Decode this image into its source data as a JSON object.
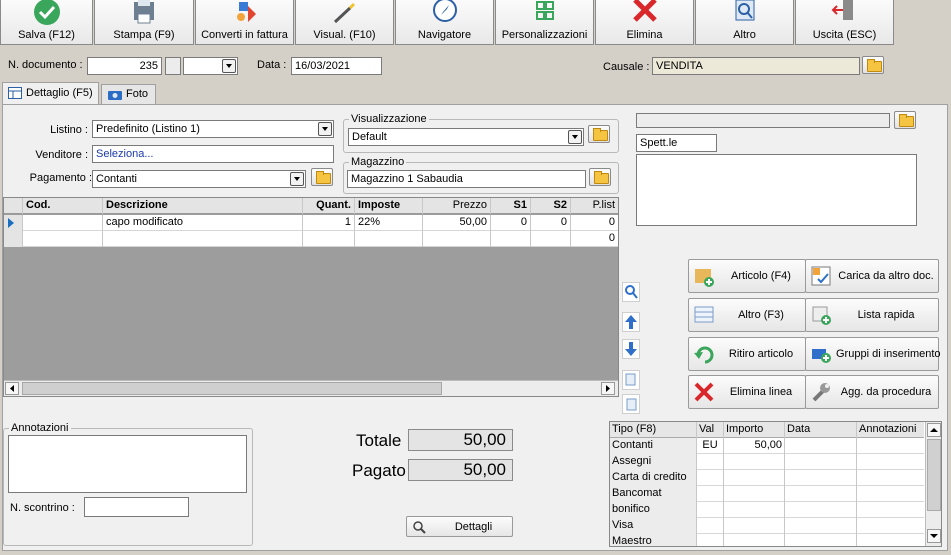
{
  "toolbar": {
    "save": "Salva (F12)",
    "print": "Stampa (F9)",
    "convert": "Converti in fattura",
    "visual": "Visual. (F10)",
    "navigator": "Navigatore",
    "custom": "Personalizzazioni",
    "delete": "Elimina",
    "other": "Altro",
    "exit": "Uscita (ESC)"
  },
  "header": {
    "doc_label": "N. documento :",
    "doc_number": "235",
    "date_label": "Data :",
    "date": "16/03/2021",
    "causale_label": "Causale :",
    "causale": "VENDITA"
  },
  "tabs": {
    "detail": "Dettaglio (F5)",
    "photo": "Foto"
  },
  "form": {
    "listino_label": "Listino :",
    "listino": "Predefinito (Listino 1)",
    "venditore_label": "Venditore :",
    "venditore": "Seleziona...",
    "pagamento_label": "Pagamento :",
    "pagamento": "Contanti",
    "visual_title": "Visualizzazione",
    "visual_value": "Default",
    "magazzino_title": "Magazzino",
    "magazzino_value": "Magazzino 1 Sabaudia",
    "customer_title": "Spett.le"
  },
  "grid": {
    "headers": {
      "cod": "Cod.",
      "desc": "Descrizione",
      "qty": "Quant.",
      "tax": "Imposte",
      "price": "Prezzo",
      "s1": "S1",
      "s2": "S2",
      "plist": "P.list"
    },
    "row1": {
      "desc": "capo modificato",
      "qty": "1",
      "tax": "22%",
      "price": "50,00",
      "s1": "0",
      "s2": "0",
      "plist": "0"
    },
    "row2": {
      "plist": "0"
    }
  },
  "actions": {
    "article": "Articolo (F4)",
    "load_doc": "Carica da altro doc.",
    "other": "Altro (F3)",
    "quick_list": "Lista rapida",
    "return": "Ritiro articolo",
    "groups": "Gruppi di inserimento",
    "delete_line": "Elimina linea",
    "add_procedure": "Agg. da procedura"
  },
  "notes": {
    "title": "Annotazioni",
    "receipt_label": "N. scontrino :"
  },
  "totals": {
    "total_label": "Totale",
    "total": "50,00",
    "paid_label": "Pagato",
    "paid": "50,00",
    "details": "Dettagli"
  },
  "payments": {
    "headers": {
      "type": "Tipo (F8)",
      "val": "Val",
      "amount": "Importo",
      "date": "Data",
      "notes": "Annotazioni"
    },
    "rows": [
      {
        "type": "Contanti",
        "val": "EU",
        "amount": "50,00"
      },
      {
        "type": "Assegni"
      },
      {
        "type": "Carta di credito"
      },
      {
        "type": "Bancomat"
      },
      {
        "type": "bonifico"
      },
      {
        "type": "Visa"
      },
      {
        "type": "Maestro"
      }
    ]
  },
  "colors": {
    "save_green": "#3aa65b",
    "delete_red": "#d9272b",
    "arrow_blue": "#2f6fc9"
  }
}
